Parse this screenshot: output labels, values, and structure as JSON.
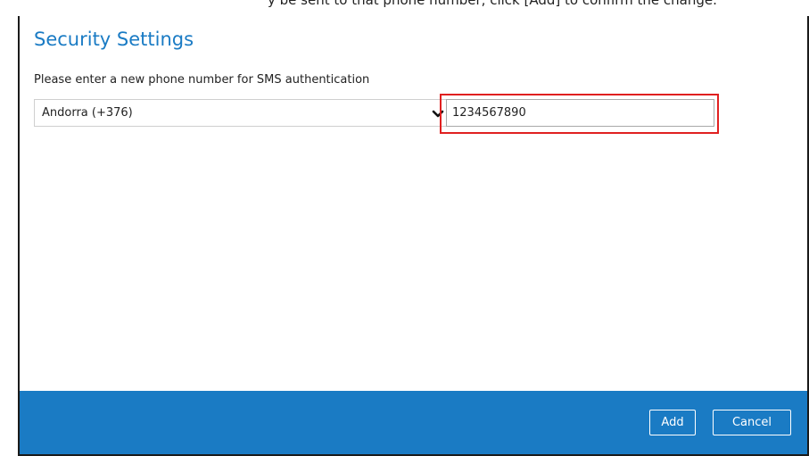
{
  "caption": {
    "cropped_text": "y be sent to that phone number, click [Add] to confirm the change."
  },
  "dialog": {
    "title": "Security Settings",
    "instruction": "Please enter a new phone number for SMS authentication"
  },
  "country_select": {
    "selected": "Andorra (+376)",
    "icon": "chevron-down-icon"
  },
  "phone_input": {
    "value": "1234567890",
    "placeholder": ""
  },
  "footer": {
    "add_label": "Add",
    "cancel_label": "Cancel"
  },
  "colors": {
    "accent": "#1a7bc4",
    "highlight": "#e02020",
    "footer_bg": "#1a7bc4"
  }
}
